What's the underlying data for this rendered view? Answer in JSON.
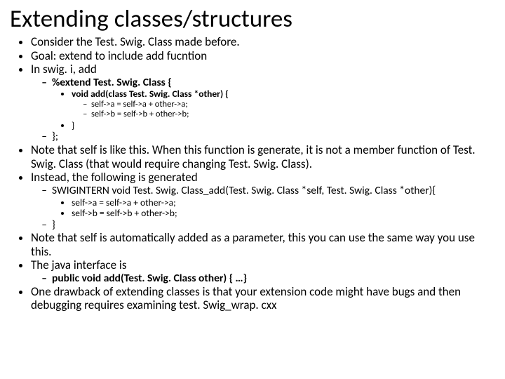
{
  "title": "Extending classes/structures",
  "b": {
    "l1a": "Consider the Test. Swig. Class made before.",
    "l1b": "Goal: extend to include add fucntion",
    "l1c": "In swig. i, add",
    "l2a": "%extend Test. Swig. Class {",
    "l3a": "void add(class Test. Swig. Class *other) {",
    "l4a": "self->a = self->a + other->a;",
    "l4b": "self->b = self->b + other->b;",
    "l3b": "}",
    "l2b": "};",
    "l1d": "Note that self is like this. When this function is generate, it is not a member function of Test. Swig. Class (that would require changing Test. Swig. Class).",
    "l1e": "Instead, the following is generated",
    "l2c": "SWIGINTERN void Test. Swig. Class_add(Test. Swig. Class *self, Test. Swig. Class *other){",
    "l3c": "self->a = self->a + other->a;",
    "l3d": "self->b = self->b + other->b;",
    "l2d": "}",
    "l1f": "Note that self is automatically added as a parameter, this you can use the same way you use this.",
    "l1g": "The java interface is",
    "l2e": "public void add(Test. Swig. Class other) { …}",
    "l1h": "One drawback of extending classes is that your extension code might have bugs and then debugging requires examining test. Swig_wrap. cxx"
  }
}
